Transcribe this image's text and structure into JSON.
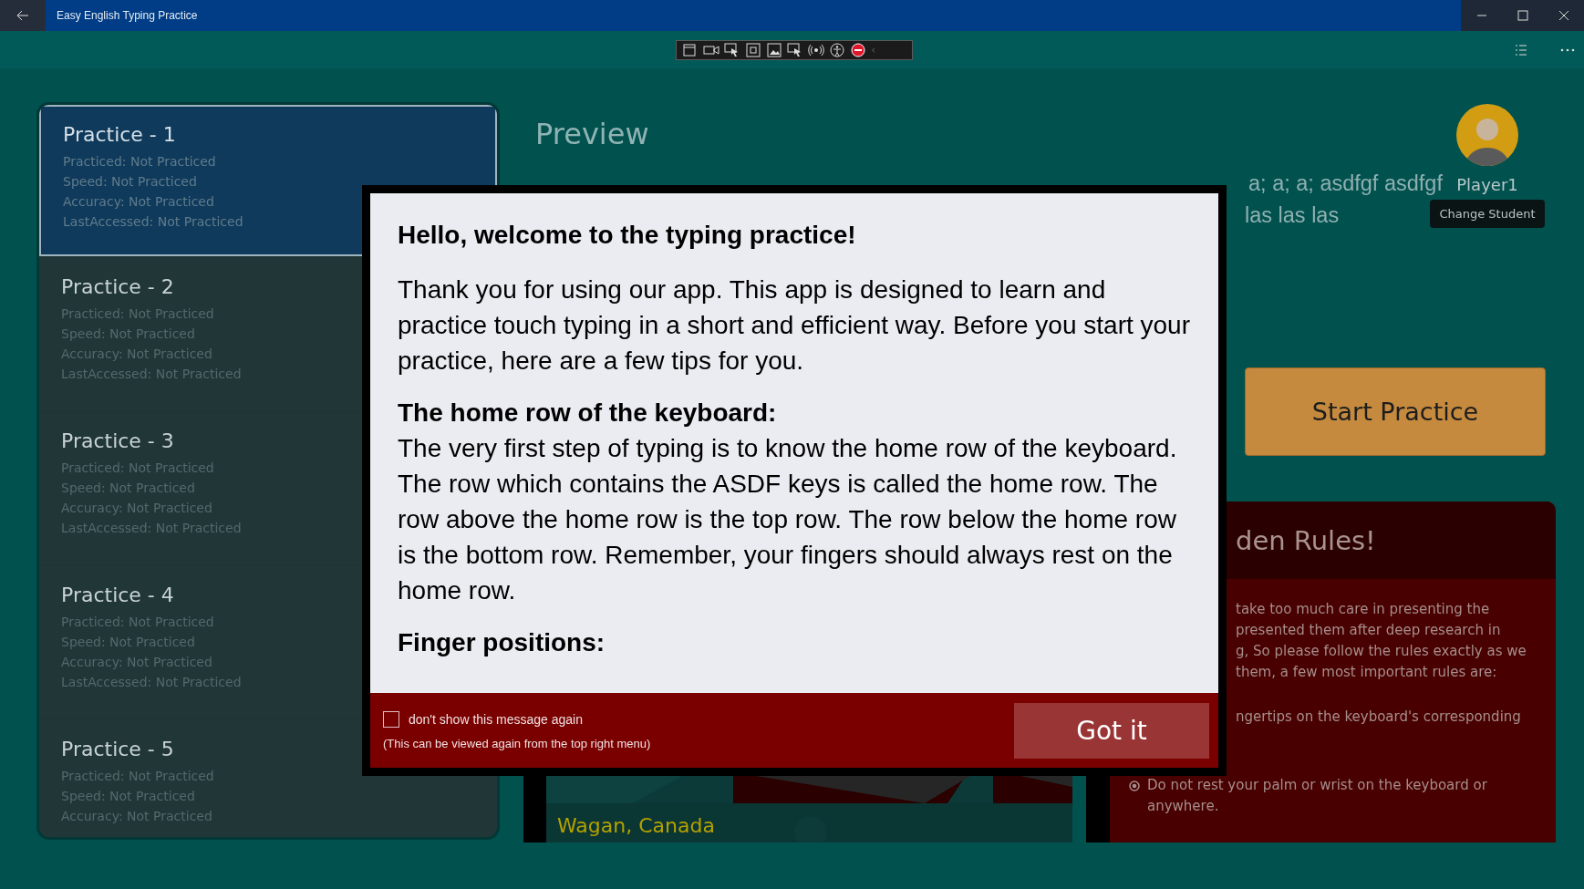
{
  "window": {
    "title": "Easy English Typing Practice"
  },
  "practices": [
    {
      "title": "Practice - 1",
      "selected": true,
      "details": [
        "Practiced: Not Practiced",
        "Speed: Not Practiced",
        "Accuracy: Not Practiced",
        "LastAccessed: Not Practiced"
      ]
    },
    {
      "title": "Practice - 2",
      "selected": false,
      "details": [
        "Practiced: Not Practiced",
        "Speed: Not Practiced",
        "Accuracy: Not Practiced",
        "LastAccessed: Not Practiced"
      ]
    },
    {
      "title": "Practice - 3",
      "selected": false,
      "details": [
        "Practiced: Not Practiced",
        "Speed: Not Practiced",
        "Accuracy: Not Practiced",
        "LastAccessed: Not Practiced"
      ]
    },
    {
      "title": "Practice - 4",
      "selected": false,
      "details": [
        "Practiced: Not Practiced",
        "Speed: Not Practiced",
        "Accuracy: Not Practiced",
        "LastAccessed: Not Practiced"
      ]
    },
    {
      "title": "Practice - 5",
      "selected": false,
      "details": [
        "Practiced: Not Practiced",
        "Speed: Not Practiced",
        "Accuracy: Not Practiced"
      ]
    }
  ],
  "preview": {
    "title": "Preview",
    "lines": [
      "a; a; a; asdfgf asdfgf",
      "las las las"
    ]
  },
  "student": {
    "name": "Player1",
    "button": "Change Student"
  },
  "start_button": "Start Practice",
  "rules": {
    "title": "den Rules!",
    "intro_lines": [
      "take too much care in presenting the",
      "presented them after deep research in",
      "g, So please follow the rules exactly as we",
      "them, a few most important rules are:"
    ],
    "bullets": [
      {
        "kind": "fragment",
        "text": "ngertips on the keyboard's corresponding"
      },
      {
        "kind": "bullet",
        "text": "Do not rest your palm or wrist on the keyboard or anywhere."
      }
    ]
  },
  "photo_caption": "Wagan, Canada",
  "dialog": {
    "heading": "Hello, welcome to the typing practice!",
    "blocks": [
      {
        "kind": "text",
        "text": "Thank you for using our app. This app is designed to learn and practice touch typing in a short and efficient way. Before you start your practice, here are a few tips for you."
      },
      {
        "kind": "section",
        "title": "The home row of the keyboard:",
        "text": "The very first step of typing is to know the home row of the keyboard. The row which contains the ASDF keys is called the home row. The row above the home row is the top row. The row below the home row is the bottom row. Remember, your fingers should always rest on the home row."
      },
      {
        "kind": "heading",
        "text": "Finger positions:"
      }
    ],
    "checkbox": {
      "label": "don't show this message again",
      "checked": false
    },
    "note": "(This can be viewed again from the top right menu)",
    "button": "Got it"
  }
}
